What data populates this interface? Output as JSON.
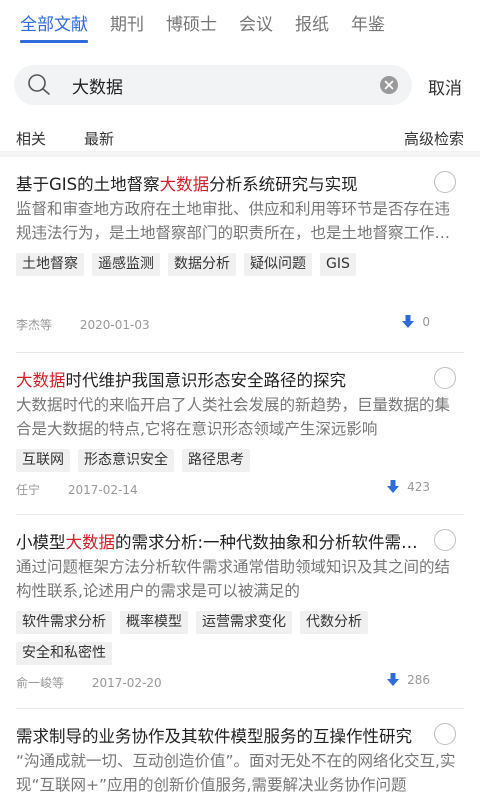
{
  "tabs": [
    {
      "label": "全部文献",
      "active": true
    },
    {
      "label": "期刊"
    },
    {
      "label": "博硕士"
    },
    {
      "label": "会议"
    },
    {
      "label": "报纸"
    },
    {
      "label": "年鉴"
    }
  ],
  "search": {
    "value": "大数据",
    "cancel_label": "取消"
  },
  "sort": {
    "related": "相关",
    "latest": "最新",
    "advanced": "高级检索"
  },
  "results": [
    {
      "title_pre": "基于GIS的土地督察",
      "title_hl": "大数据",
      "title_post": "分析系统研究与实现",
      "abstract": "监督和审查地方政府在土地审批、供应和利用等环节是否存在违规违法行为，是土地督察部门的职责所在，也是土地督察工作的重要内容",
      "tags": [
        "土地督察",
        "遥感监测",
        "数据分析",
        "疑似问题",
        "GIS"
      ],
      "author": "李杰等",
      "date": "2020-01-03",
      "downloads": "0"
    },
    {
      "title_pre": "",
      "title_hl": "大数据",
      "title_post": "时代维护我国意识形态安全路径的探究",
      "abstract": "大数据时代的来临开启了人类社会发展的新趋势，巨量数据的集合是大数据的特点,它将在意识形态领域产生深远影响",
      "tags": [
        "互联网",
        "形态意识安全",
        "路径思考"
      ],
      "author": "任宁",
      "date": "2017-02-14",
      "downloads": "423"
    },
    {
      "title_pre": "小模型",
      "title_hl": "大数据",
      "title_post": "的需求分析:一种代数抽象和分析软件需求的方法",
      "abstract": "通过问题框架方法分析软件需求通常借助领域知识及其之间的结构性联系,论述用户的需求是可以被满足的",
      "tags": [
        "软件需求分析",
        "概率模型",
        "运营需求变化",
        "代数分析",
        "安全和私密性"
      ],
      "author": "俞一峻等",
      "date": "2017-02-20",
      "downloads": "286"
    },
    {
      "title_pre": "需求制导的业务协作及其软件模型服务的互操作性研究",
      "title_hl": "",
      "title_post": "",
      "abstract": "“沟通成就一切、互动创造价值”。面对无处不在的网络化交互,实现“互联网+”应用的创新价值服务,需要解决业务协作问题",
      "tags": [],
      "author": "",
      "date": "",
      "downloads": ""
    }
  ]
}
